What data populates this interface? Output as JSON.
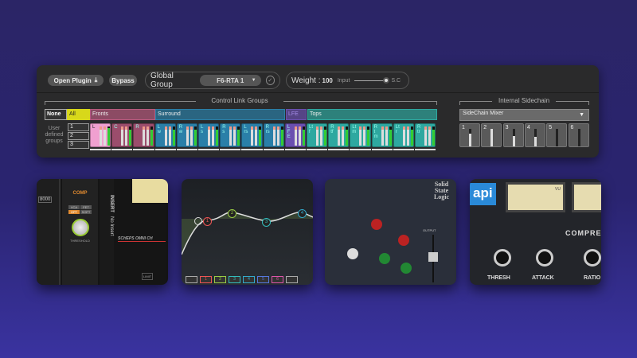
{
  "toolbar": {
    "open_plugin": "Open Plugin",
    "bypass": "Bypass",
    "global_group_label": "Global Group",
    "global_group_value": "F6-RTA 1",
    "weight_label": "Weight :",
    "weight_value": "100",
    "input_label": "Input",
    "sc_label": "S.C"
  },
  "control_link": {
    "title": "Control Link Groups",
    "none": "None",
    "groups": [
      {
        "name": "All",
        "color": "#d8d81a"
      },
      {
        "name": "Fronts",
        "color": "#b85a7e"
      },
      {
        "name": "Surround",
        "color": "#2a7fa8"
      },
      {
        "name": "LFE",
        "color": "#6a4fb0"
      },
      {
        "name": "Tops",
        "color": "#2ea8a0"
      }
    ],
    "user_groups_label": "User defined groups",
    "user_groups": [
      "1",
      "2",
      "3"
    ],
    "channels": [
      {
        "n": "L",
        "g": "pink",
        "lvl": 0.9
      },
      {
        "n": "C",
        "g": "fronts",
        "lvl": 0.85
      },
      {
        "n": "R",
        "g": "fronts",
        "lvl": 0.85
      },
      {
        "n": "Lw",
        "g": "surround",
        "lvl": 0.85
      },
      {
        "n": "Rw",
        "g": "surround",
        "lvl": 0.85
      },
      {
        "n": "Ls",
        "g": "surround",
        "lvl": 0.85
      },
      {
        "n": "Rs",
        "g": "surround",
        "lvl": 0.85
      },
      {
        "n": "Lrs",
        "g": "surround",
        "lvl": 0.85
      },
      {
        "n": "Rrs",
        "g": "surround",
        "lvl": 0.85
      },
      {
        "n": "LFE",
        "g": "lfe",
        "lvl": 0.85
      },
      {
        "n": "Ltf",
        "g": "tops",
        "lvl": 0.85
      },
      {
        "n": "Rtf",
        "g": "tops",
        "lvl": 0.85
      },
      {
        "n": "Ltm",
        "g": "tops",
        "lvl": 0.85
      },
      {
        "n": "Rtm",
        "g": "tops",
        "lvl": 0.85
      },
      {
        "n": "Ltr",
        "g": "tops",
        "lvl": 0.85
      },
      {
        "n": "Rtr",
        "g": "tops",
        "lvl": 0.85
      }
    ]
  },
  "sidechain": {
    "title": "Internal Sidechain",
    "mixer": "SideChain Mixer",
    "channels": [
      {
        "n": "1",
        "lvl": 0.75
      },
      {
        "n": "2",
        "lvl": 1.0
      },
      {
        "n": "3",
        "lvl": 0.6
      },
      {
        "n": "4",
        "lvl": 0.55
      },
      {
        "n": "5",
        "lvl": 0
      },
      {
        "n": "6",
        "lvl": 0
      }
    ]
  },
  "thumbs": {
    "t1": {
      "comp": "COMP",
      "modes": [
        "VCA",
        "FET",
        "OPT",
        "SOFT"
      ],
      "threshold": "THRESHOLD",
      "insert": "INSERT",
      "no_insert": "No Insert",
      "brand": "SCHEPS OMNI CH",
      "limit": "LIMIT",
      "freq": "8000"
    },
    "t2": {
      "bands": [
        "1",
        "2",
        "3",
        "4",
        "5",
        "6"
      ],
      "nodes": [
        "1",
        "2",
        "3",
        "4"
      ]
    },
    "t3": {
      "brand": "Solid State Logic",
      "output": "OUTPUT"
    },
    "t4": {
      "brand": "api",
      "vu": "VU",
      "section": "COMPRE",
      "knobs": [
        "THRESH",
        "ATTACK",
        "RATIO"
      ]
    }
  }
}
